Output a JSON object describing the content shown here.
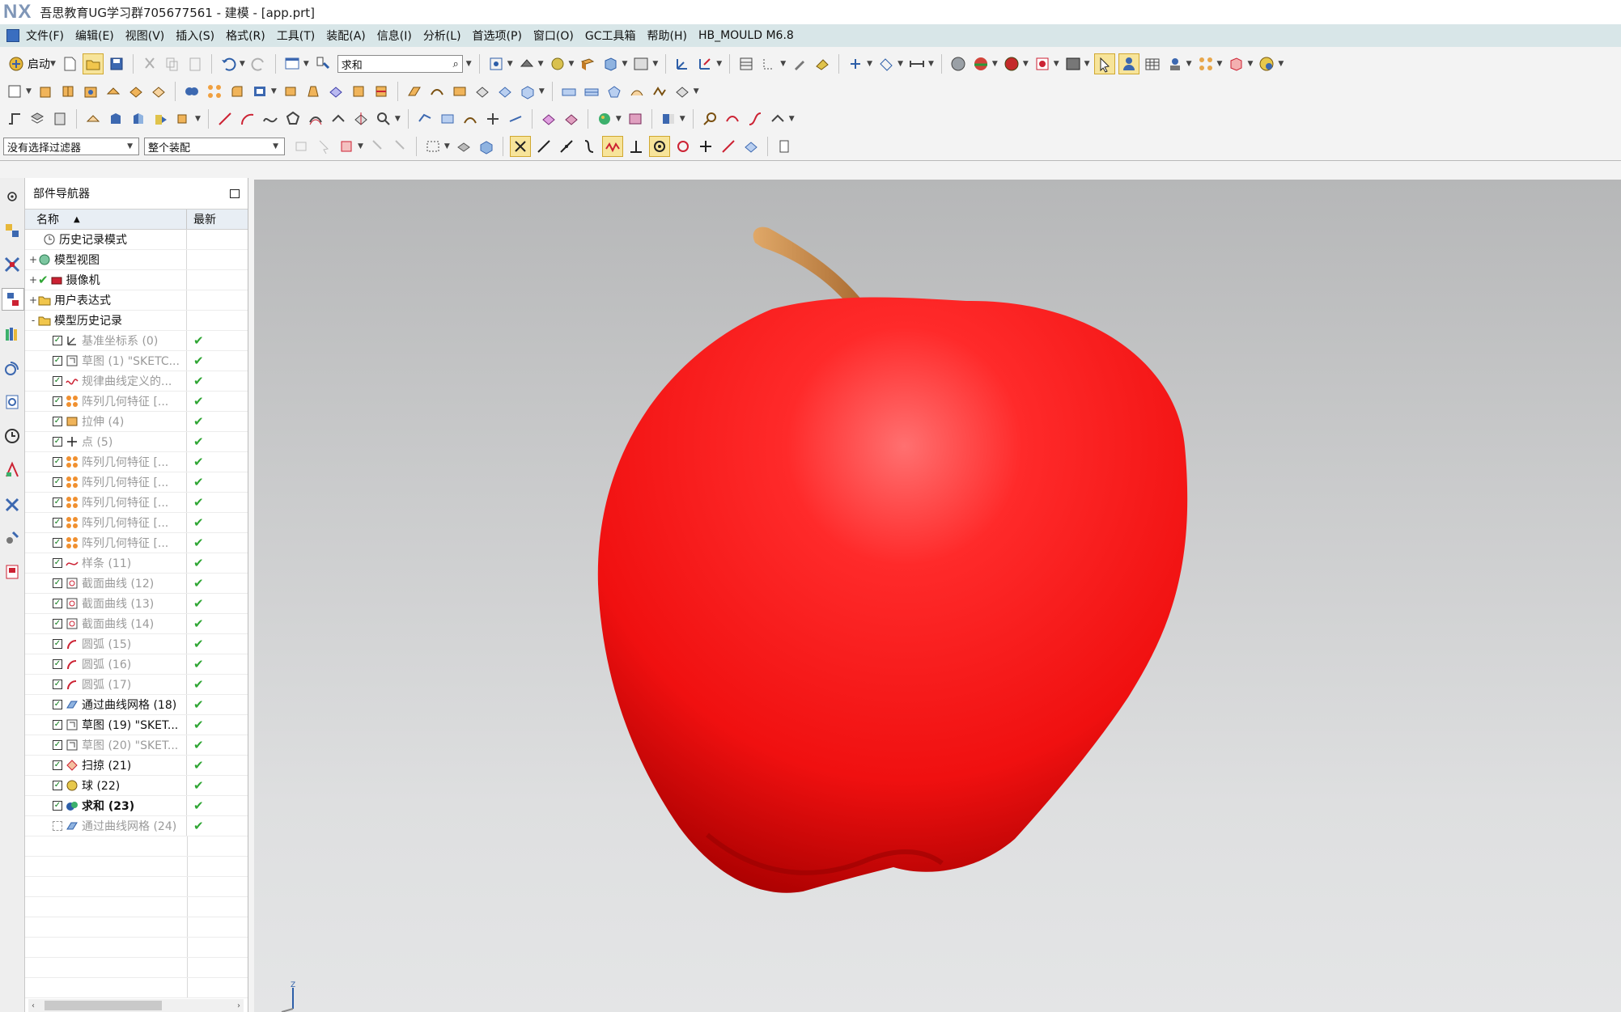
{
  "window": {
    "logo": "NX",
    "title": "吾思教育UG学习群705677561 - 建模 - [app.prt]"
  },
  "menubar": {
    "items": [
      "文件(F)",
      "编辑(E)",
      "视图(V)",
      "插入(S)",
      "格式(R)",
      "工具(T)",
      "装配(A)",
      "信息(I)",
      "分析(L)",
      "首选项(P)",
      "窗口(O)",
      "GC工具箱",
      "帮助(H)",
      "HB_MOULD M6.8"
    ]
  },
  "toolbar": {
    "launch_label": "启动",
    "command_search_value": "求和"
  },
  "selection_bar": {
    "filter_value": "没有选择过滤器",
    "scope_value": "整个装配"
  },
  "navigator": {
    "title": "部件导航器",
    "col_name": "名称",
    "col_latest": "最新",
    "root_items": [
      {
        "label": "历史记录模式",
        "expander": ""
      },
      {
        "label": "模型视图",
        "expander": "+"
      },
      {
        "label": "摄像机",
        "expander": "+"
      },
      {
        "label": "用户表达式",
        "expander": "+"
      },
      {
        "label": "模型历史记录",
        "expander": "-"
      }
    ],
    "history": [
      {
        "label": "基准坐标系 (0)",
        "style": "gray",
        "icon": "datum-csys-icon"
      },
      {
        "label": "草图 (1) \"SKETC...",
        "style": "gray",
        "icon": "sketch-icon"
      },
      {
        "label": "规律曲线定义的...",
        "style": "gray",
        "icon": "law-curve-icon"
      },
      {
        "label": "阵列几何特征 [...",
        "style": "gray",
        "icon": "pattern-icon"
      },
      {
        "label": "拉伸 (4)",
        "style": "gray",
        "icon": "extrude-icon"
      },
      {
        "label": "点 (5)",
        "style": "gray",
        "icon": "point-icon"
      },
      {
        "label": "阵列几何特征 [...",
        "style": "gray",
        "icon": "pattern-icon"
      },
      {
        "label": "阵列几何特征 [...",
        "style": "gray",
        "icon": "pattern-icon"
      },
      {
        "label": "阵列几何特征 [...",
        "style": "gray",
        "icon": "pattern-icon"
      },
      {
        "label": "阵列几何特征 [...",
        "style": "gray",
        "icon": "pattern-icon"
      },
      {
        "label": "阵列几何特征 [...",
        "style": "gray",
        "icon": "pattern-icon"
      },
      {
        "label": "样条 (11)",
        "style": "gray",
        "icon": "spline-icon"
      },
      {
        "label": "截面曲线 (12)",
        "style": "gray",
        "icon": "section-curve-icon"
      },
      {
        "label": "截面曲线 (13)",
        "style": "gray",
        "icon": "section-curve-icon"
      },
      {
        "label": "截面曲线 (14)",
        "style": "gray",
        "icon": "section-curve-icon"
      },
      {
        "label": "圆弧 (15)",
        "style": "gray",
        "icon": "arc-icon"
      },
      {
        "label": "圆弧 (16)",
        "style": "gray",
        "icon": "arc-icon"
      },
      {
        "label": "圆弧 (17)",
        "style": "gray",
        "icon": "arc-icon"
      },
      {
        "label": "通过曲线网格 (18)",
        "style": "normal",
        "icon": "curve-mesh-icon"
      },
      {
        "label": "草图 (19) \"SKET...",
        "style": "normal",
        "icon": "sketch-icon"
      },
      {
        "label": "草图 (20) \"SKET...",
        "style": "gray",
        "icon": "sketch-icon"
      },
      {
        "label": "扫掠 (21)",
        "style": "normal",
        "icon": "swept-icon"
      },
      {
        "label": "球 (22)",
        "style": "normal",
        "icon": "sphere-icon"
      },
      {
        "label": "求和 (23)",
        "style": "bold",
        "icon": "unite-icon"
      },
      {
        "label": "通过曲线网格 (24)",
        "style": "gray",
        "icon": "curve-mesh-icon"
      }
    ]
  },
  "viewport": {
    "model": "apple",
    "triad_label": "Z",
    "colors": {
      "apple": "#ff1010",
      "stem": "#c98c4e"
    }
  }
}
